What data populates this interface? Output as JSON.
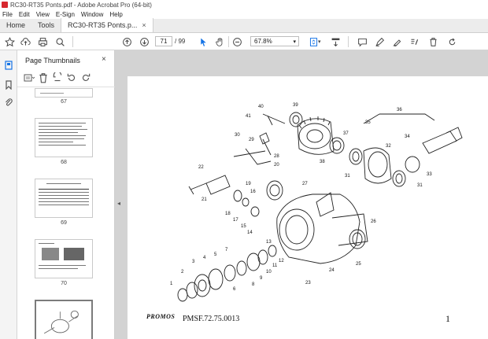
{
  "window": {
    "title": "RC30-RT35 Ponts.pdf - Adobe Acrobat Pro (64-bit)"
  },
  "menu": [
    "File",
    "Edit",
    "View",
    "E-Sign",
    "Window",
    "Help"
  ],
  "tabs": [
    {
      "label": "Home"
    },
    {
      "label": "Tools"
    },
    {
      "label": "RC30-RT35 Ponts.p...",
      "close": "×"
    }
  ],
  "toolbar": {
    "current_page": "71",
    "total_pages": "/ 99",
    "zoom": "67.8%"
  },
  "panel": {
    "title": "Page Thumbnails",
    "close": "×"
  },
  "thumbnails": [
    {
      "label": "67"
    },
    {
      "label": "68"
    },
    {
      "label": "69"
    },
    {
      "label": "70"
    }
  ],
  "page": {
    "logo": "PROMOS",
    "code": "PMSF.72.75.0013",
    "number": "1",
    "callouts": [
      "40",
      "39",
      "41",
      "35",
      "36",
      "30",
      "29",
      "37",
      "34",
      "32",
      "28",
      "38",
      "20",
      "31",
      "33",
      "22",
      "27",
      "31",
      "19",
      "26",
      "21",
      "16",
      "18",
      "17",
      "15",
      "14",
      "24",
      "25",
      "1",
      "2",
      "3",
      "4",
      "5",
      "6",
      "7",
      "8",
      "9",
      "10",
      "11",
      "12",
      "13",
      "23"
    ]
  },
  "colors": {
    "accent": "#1473e6",
    "brand": "#d7282f"
  }
}
